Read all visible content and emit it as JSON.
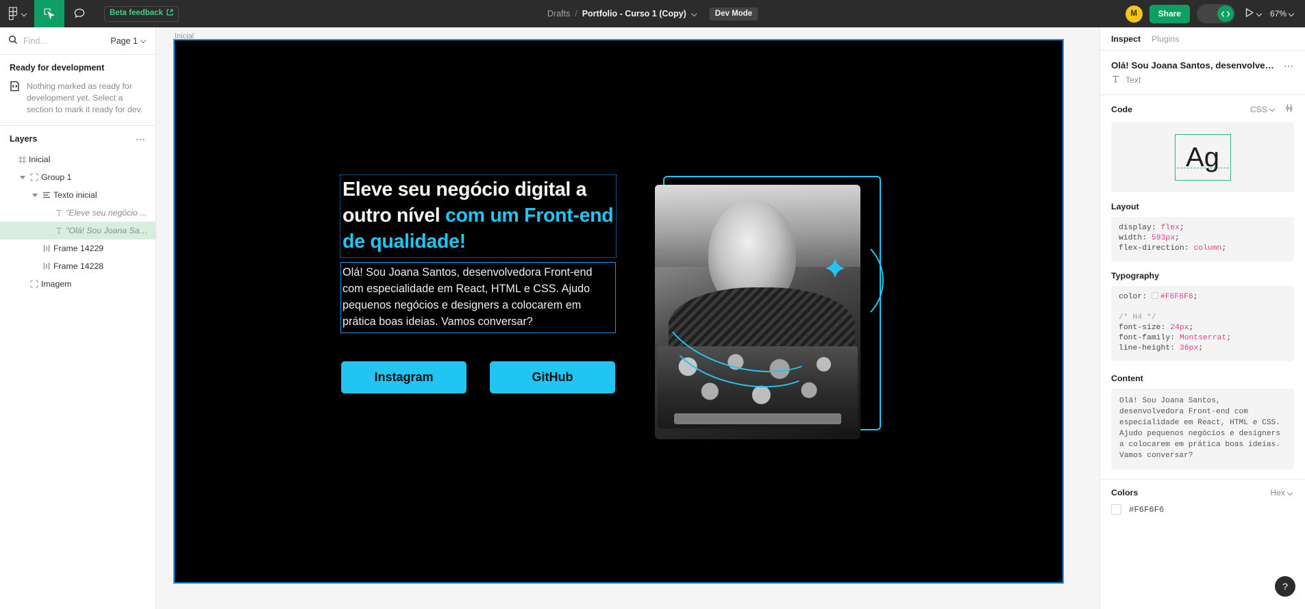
{
  "topbar": {
    "logo_icon": "figma-logo-icon",
    "logo_chevron_icon": "chevron-down-icon",
    "move_tool_icon": "cursor-move-tool-icon",
    "comment_tool_icon": "comment-bubble-icon",
    "beta_label": "Beta feedback",
    "beta_external_icon": "external-link-icon",
    "breadcrumb_project": "Drafts",
    "breadcrumb_separator": "/",
    "breadcrumb_file": "Portfolio - Curso 1 (Copy)",
    "breadcrumb_chevron_icon": "chevron-down-icon",
    "dev_mode_badge": "Dev Mode",
    "avatar_initial": "M",
    "share_label": "Share",
    "dev_toggle_icon": "code-brackets-icon",
    "present_icon": "play-triangle-icon",
    "present_chevron_icon": "chevron-down-icon",
    "zoom_level": "67%",
    "zoom_chevron_icon": "chevron-down-icon"
  },
  "left_panel": {
    "search_icon": "search-icon",
    "search_placeholder": "Find...",
    "page_selector": "Page 1",
    "page_chevron_icon": "chevron-down-icon",
    "ready_heading": "Ready for development",
    "ready_empty_icon": "code-page-icon",
    "ready_empty_text": "Nothing marked as ready for development yet. Select a section to mark it ready for dev.",
    "layers_heading": "Layers",
    "layers_more_icon": "more-horizontal-icon",
    "layers": [
      {
        "label": "Inicial",
        "icon": "section-icon",
        "depth": 0,
        "twisty": "none",
        "selected": false,
        "italic": false
      },
      {
        "label": "Group 1",
        "icon": "group-icon",
        "depth": 1,
        "twisty": "open",
        "selected": false,
        "italic": false
      },
      {
        "label": "Texto inicial",
        "icon": "autolayout-vertical-icon",
        "depth": 2,
        "twisty": "open",
        "selected": false,
        "italic": false
      },
      {
        "label": "\"Eleve seu negócio ...",
        "icon": "text-icon",
        "depth": 3,
        "twisty": "none",
        "selected": false,
        "italic": true
      },
      {
        "label": "\"Olá! Sou Joana San...",
        "icon": "text-icon",
        "depth": 3,
        "twisty": "none",
        "selected": true,
        "italic": true
      },
      {
        "label": "Frame 14229",
        "icon": "autolayout-horizontal-icon",
        "depth": 2,
        "twisty": "none",
        "selected": false,
        "italic": false
      },
      {
        "label": "Frame 14228",
        "icon": "autolayout-horizontal-icon",
        "depth": 2,
        "twisty": "none",
        "selected": false,
        "italic": false
      },
      {
        "label": "Imagem",
        "icon": "group-icon",
        "depth": 1,
        "twisty": "none",
        "selected": false,
        "italic": false
      }
    ]
  },
  "canvas": {
    "frame_label": "Inicial",
    "headline_part1": "Eleve seu negócio digital a outro nível ",
    "headline_part2": "com um Front-end de qualidade!",
    "paragraph": "Olá! Sou Joana Santos, desenvolvedora Front-end com especialidade em React, HTML e CSS. Ajudo pequenos negócios e designers a colocarem em prática boas ideias. Vamos conversar?",
    "button_instagram": "Instagram",
    "button_github": "GitHub",
    "accent_color": "#22C5F2",
    "selection_color": "#0D99FF",
    "background_color": "#000000"
  },
  "inspect": {
    "tab_inspect": "Inspect",
    "tab_plugins": "Plugins",
    "selection_title": "Olá! Sou Joana Santos, desenvolvedora...",
    "more_icon": "more-horizontal-icon",
    "node_type_icon": "text-icon",
    "node_type": "Text",
    "code_heading": "Code",
    "code_language": "CSS",
    "code_language_chevron_icon": "chevron-down-icon",
    "code_settings_icon": "sliders-settings-icon",
    "preview_glyph": "Ag",
    "layout_heading": "Layout",
    "layout_css": [
      {
        "prop": "display",
        "value": "flex"
      },
      {
        "prop": "width",
        "value": "593px"
      },
      {
        "prop": "flex-direction",
        "value": "column"
      }
    ],
    "typography_heading": "Typography",
    "typography_color_prop": "color",
    "typography_color_value": "#F6F6F6",
    "typography_comment": "/* H4 */",
    "typography_css": [
      {
        "prop": "font-size",
        "value": "24px"
      },
      {
        "prop": "font-family",
        "value": "Montserrat"
      },
      {
        "prop": "line-height",
        "value": "36px"
      }
    ],
    "content_heading": "Content",
    "content_text": "Olá! Sou Joana Santos, desenvolvedora Front-end com especialidade em React, HTML e CSS. Ajudo pequenos negócios e designers a colocarem em prática boas ideias. Vamos conversar?",
    "colors_heading": "Colors",
    "colors_format": "Hex",
    "colors_format_chevron_icon": "chevron-down-icon",
    "colors": [
      {
        "hex": "#F6F6F6"
      }
    ],
    "help_label": "?"
  }
}
